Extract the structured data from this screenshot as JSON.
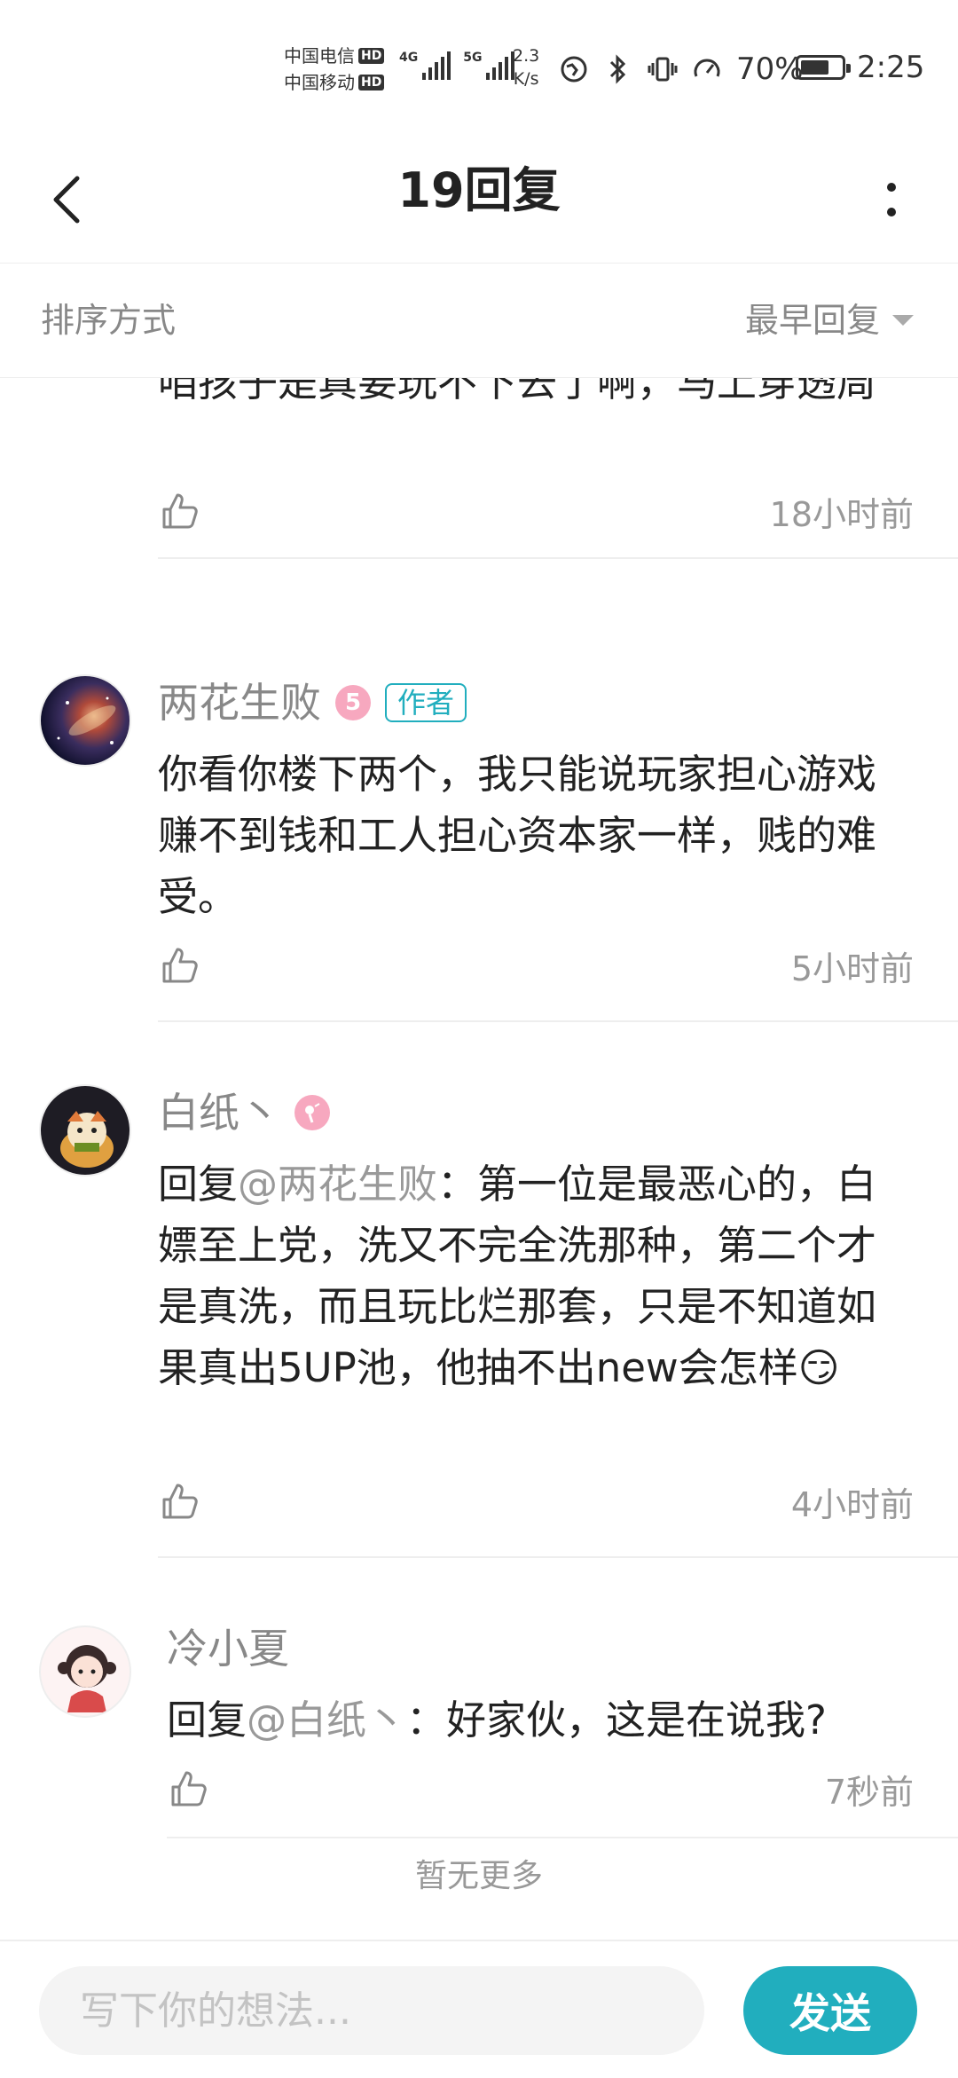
{
  "status_bar": {
    "carrier_1": "中国电信",
    "carrier_2": "中国移动",
    "hd_label": "HD",
    "net_1": "4G",
    "net_2": "5G",
    "net_speed_value": "2.3",
    "net_speed_unit": "K/s",
    "battery_percent": "70%",
    "battery_level": 0.7,
    "time": "2:25"
  },
  "nav": {
    "title": "19回复"
  },
  "sort": {
    "label": "排序方式",
    "selected": "最早回复"
  },
  "comments": [
    {
      "body": "咱孩子是真要玩不下去了啊，马上穿透周",
      "time": "18小时前"
    },
    {
      "name": "两花生败",
      "level": "5",
      "author_tag": "作者",
      "body": "你看你楼下两个，我只能说玩家担心游戏赚不到钱和工人担心资本家一样，贱的难受。",
      "time": "5小时前"
    },
    {
      "name": "白纸丶",
      "body_prefix": "回复",
      "mention": "@两花生败",
      "body": "：第一位是最恶心的，白嫖至上党，洗又不完全洗那种，第二个才是真洗，而且玩比烂那套，只是不知道如果真出5UP池，他抽不出new会怎样😏",
      "time": "4小时前"
    },
    {
      "name": "冷小夏",
      "body_prefix": "回复",
      "mention": "@白纸丶",
      "body": "：好家伙，这是在说我?",
      "time": "7秒前"
    }
  ],
  "footer_note": "暂无更多",
  "composer": {
    "placeholder": "写下你的想法...",
    "send_label": "发送"
  },
  "colors": {
    "accent": "#21aebe",
    "muted_text": "#999999",
    "badge_pink": "#f7a8bf"
  }
}
